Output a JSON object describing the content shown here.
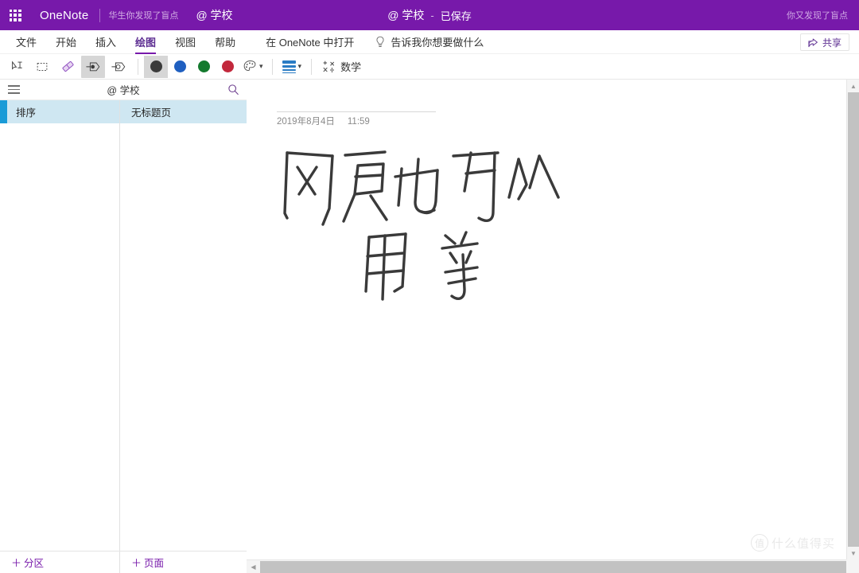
{
  "titlebar": {
    "app_name": "OneNote",
    "watermark_left": "华生你发现了盲点",
    "school_tag": "@ 学校",
    "doc_title": "@ 学校",
    "separator": "-",
    "save_status": "已保存",
    "watermark_right": "你又发现了盲点",
    "brand_color": "#7719aa"
  },
  "ribbon": {
    "tabs": [
      {
        "label": "文件",
        "active": false
      },
      {
        "label": "开始",
        "active": false
      },
      {
        "label": "插入",
        "active": false
      },
      {
        "label": "绘图",
        "active": true
      },
      {
        "label": "视图",
        "active": false
      },
      {
        "label": "帮助",
        "active": false
      }
    ],
    "open_in_app": "在 OneNote 中打开",
    "tell_me": "告诉我你想要做什么",
    "share_label": "共享",
    "active_tab_color": "#7719aa"
  },
  "drawbar": {
    "tools": [
      {
        "name": "type-select-tool",
        "selected": false
      },
      {
        "name": "lasso-select-tool",
        "selected": false
      },
      {
        "name": "eraser-tool",
        "selected": false
      },
      {
        "name": "pen-tool",
        "selected": true
      },
      {
        "name": "highlighter-tool",
        "selected": false
      }
    ],
    "colors": [
      {
        "name": "black",
        "hex": "#3b3b3b",
        "selected": true
      },
      {
        "name": "blue",
        "hex": "#1f5fc0",
        "selected": false
      },
      {
        "name": "green",
        "hex": "#147a2e",
        "selected": false
      },
      {
        "name": "red",
        "hex": "#c2283c",
        "selected": false
      }
    ],
    "thickness_color": "#2b7cc4",
    "math_label": "数学"
  },
  "nav": {
    "title": "@ 学校",
    "sections": [
      {
        "label": "排序",
        "selected": true
      }
    ],
    "pages": [
      {
        "label": "无标题页",
        "selected": true
      }
    ],
    "add_section_label": "分区",
    "add_page_label": "页面",
    "plus": "＋",
    "accent_color": "#1a9bd7",
    "selected_bg": "#cfe7f2"
  },
  "page": {
    "title": "",
    "date": "2019年8月4日",
    "time": "11:59",
    "ink_note_text": "网页也可以用笔",
    "watermark_logo": "值",
    "watermark_text": "什么值得买"
  }
}
